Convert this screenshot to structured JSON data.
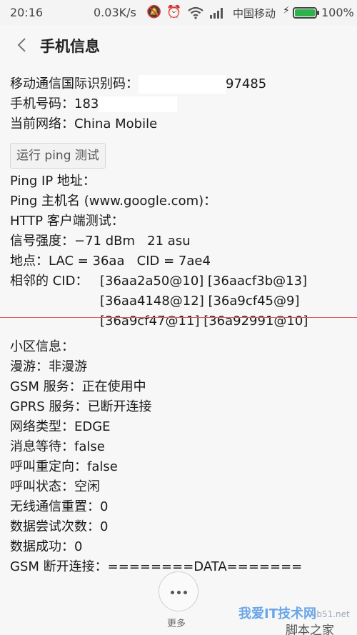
{
  "status_bar": {
    "time": "20:16",
    "speed": "0.03K/s",
    "carrier": "中国移动",
    "battery_percent": "100%",
    "battery_level": 1.0,
    "icons": [
      "mute-icon",
      "alarm-icon",
      "wifi-icon",
      "signal-icon",
      "charging-icon",
      "battery-icon"
    ]
  },
  "header": {
    "title": "手机信息",
    "back_icon": "chevron-left-icon"
  },
  "info": {
    "imei_label": "移动通信国际识别码：",
    "imei_value": "97485",
    "phone_label": "手机号码：",
    "phone_value": "183",
    "network_label": "当前网络：",
    "network_value": "China Mobile",
    "ping_button": "运行 ping 测试",
    "ping_ip_label": "Ping IP 地址：",
    "ping_host_label": "Ping 主机名 (www.google.com)：",
    "http_label": "HTTP 客户端测试：",
    "signal_label": "信号强度：",
    "signal_value": "−71 dBm   21 asu",
    "location_label": "地点：",
    "location_value": "LAC = 36aa   CID = 7ae4",
    "neighbor_label": "相邻的 CID：",
    "neighbor_lines": [
      "[36aa2a50@10] [36aacf3b@13]",
      "[36aa4148@12] [36a9cf45@9]",
      "[36a9cf47@11] [36a92991@10]"
    ],
    "cell_label": "小区信息：",
    "roaming_label": "漫游：",
    "roaming_value": "非漫游",
    "gsm_label": "GSM 服务：",
    "gsm_value": "正在使用中",
    "gprs_label": "GPRS 服务：",
    "gprs_value": "已断开连接",
    "nettype_label": "网络类型：",
    "nettype_value": "EDGE",
    "msgwait_label": "消息等待：",
    "msgwait_value": "false",
    "callfwd_label": "呼叫重定向：",
    "callfwd_value": "false",
    "callstate_label": "呼叫状态：",
    "callstate_value": "空闲",
    "radioreset_label": "无线通信重置：",
    "radioreset_value": "0",
    "dataretry_label": "数据尝试次数：",
    "dataretry_value": "0",
    "datasuccess_label": "数据成功：",
    "datasuccess_value": "0",
    "gsmdisc_label": "GSM 断开连接：",
    "gsmdisc_value": "========DATA======="
  },
  "footer": {
    "more_label": "更多"
  },
  "watermark": {
    "line1": "我爱IT技术网",
    "line2": "jb51.net",
    "line3": "脚本之家"
  }
}
